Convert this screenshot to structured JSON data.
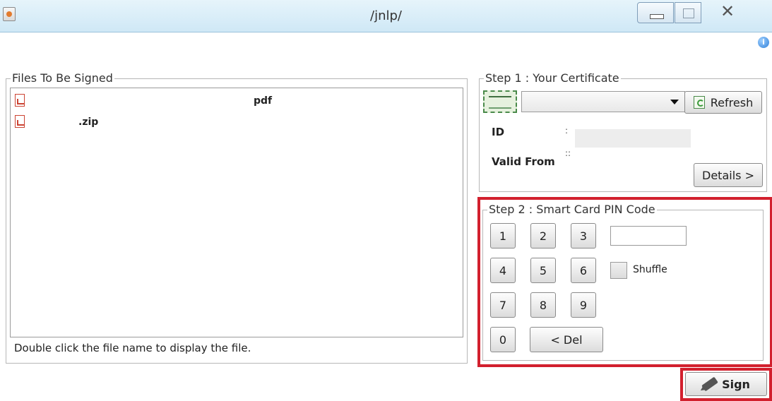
{
  "window": {
    "title": "/jnlp/",
    "close_glyph": "✕",
    "info_glyph": "i"
  },
  "files_panel": {
    "title": "Files To Be Signed",
    "files": [
      "pdf",
      ".zip"
    ],
    "hint": "Double click the file name to display the file."
  },
  "certificate_panel": {
    "title": "Step 1 : Your Certificate",
    "refresh_label": "Refresh",
    "id_label": "ID",
    "id_colon": ":",
    "valid_from_label": "Valid From",
    "valid_from_colon": "::",
    "details_label": "Details >"
  },
  "pin_panel": {
    "title": "Step 2 : Smart Card PIN Code",
    "keys": [
      "1",
      "2",
      "3",
      "4",
      "5",
      "6",
      "7",
      "8",
      "9",
      "0"
    ],
    "del_label": "< Del",
    "shuffle_label": "Shuffle"
  },
  "sign_label": "Sign",
  "colors": {
    "highlight": "#d2202e",
    "titlebar": "#cfe8f6"
  },
  "icons": [
    "java-app-icon",
    "minimize-icon",
    "maximize-icon",
    "close-icon",
    "info-icon",
    "pdf-file-icon",
    "certificate-icon",
    "dropdown-arrow-icon",
    "refresh-icon",
    "pencil-icon"
  ]
}
